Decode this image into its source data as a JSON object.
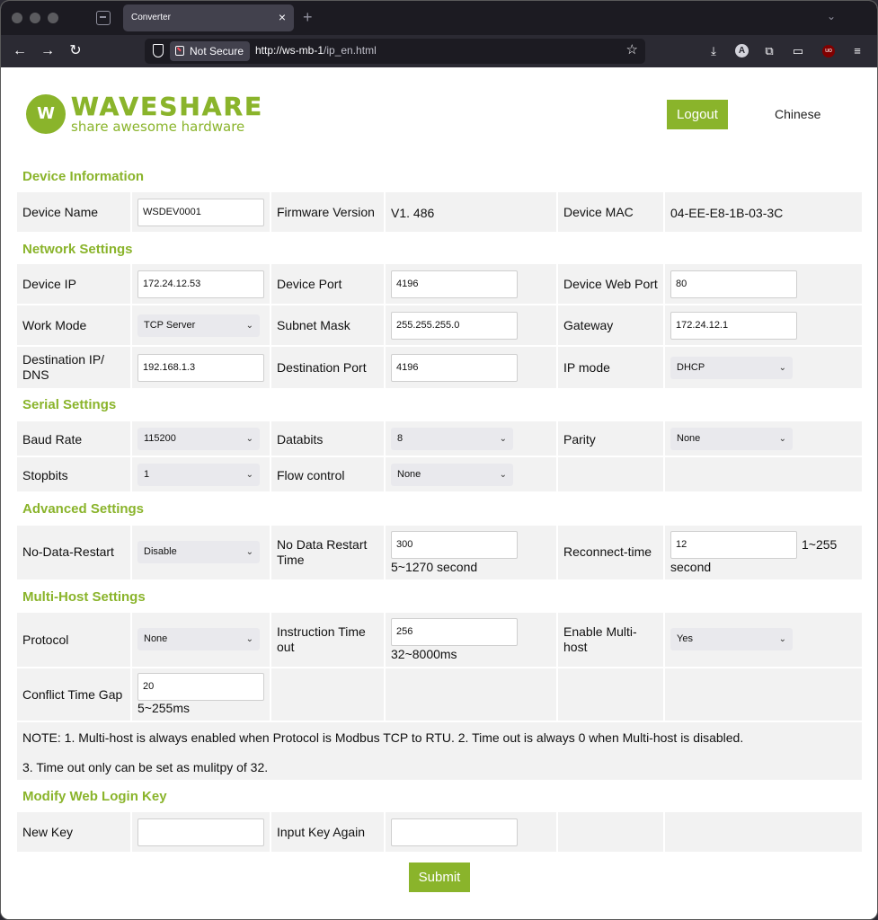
{
  "browser": {
    "tab_title": "Converter",
    "not_secure": "Not Secure",
    "url_host": "http://ws-mb-1",
    "url_path": "/ip_en.html"
  },
  "header": {
    "logo_badge": "W",
    "brand": "WAVESHARE",
    "tagline": "share awesome hardware",
    "logout": "Logout",
    "language": "Chinese"
  },
  "device_info": {
    "title": "Device Information",
    "device_name_label": "Device Name",
    "device_name": "WSDEV0001",
    "firmware_label": "Firmware Version",
    "firmware": "V1. 486",
    "mac_label": "Device MAC",
    "mac": "04-EE-E8-1B-03-3C"
  },
  "network": {
    "title": "Network Settings",
    "device_ip_label": "Device IP",
    "device_ip": "172.24.12.53",
    "device_port_label": "Device Port",
    "device_port": "4196",
    "web_port_label": "Device Web Port",
    "web_port": "80",
    "work_mode_label": "Work Mode",
    "work_mode": "TCP Server",
    "subnet_label": "Subnet Mask",
    "subnet": "255.255.255.0",
    "gateway_label": "Gateway",
    "gateway": "172.24.12.1",
    "dest_ip_label_1": "Destination IP/",
    "dest_ip_label_2": "DNS",
    "dest_ip": "192.168.1.3",
    "dest_port_label": "Destination Port",
    "dest_port": "4196",
    "ip_mode_label": "IP mode",
    "ip_mode": "DHCP"
  },
  "serial": {
    "title": "Serial Settings",
    "baud_label": "Baud Rate",
    "baud": "115200",
    "databits_label": "Databits",
    "databits": "8",
    "parity_label": "Parity",
    "parity": "None",
    "stopbits_label": "Stopbits",
    "stopbits": "1",
    "flow_label": "Flow control",
    "flow": "None"
  },
  "advanced": {
    "title": "Advanced Settings",
    "ndr_label": "No-Data-Restart",
    "ndr": "Disable",
    "ndr_time_label_1": "No Data Restart",
    "ndr_time_label_2": "Time",
    "ndr_time": "300",
    "ndr_time_hint": "5~1270 second",
    "reconnect_label": "Reconnect-time",
    "reconnect": "12",
    "reconnect_hint_1": "1~255",
    "reconnect_hint_2": "second"
  },
  "multihost": {
    "title": "Multi-Host Settings",
    "protocol_label": "Protocol",
    "protocol": "None",
    "timeout_label_1": "Instruction Time",
    "timeout_label_2": "out",
    "timeout": "256",
    "timeout_hint": "32~8000ms",
    "enable_label_1": "Enable Multi-",
    "enable_label_2": "host",
    "enable": "Yes",
    "gap_label": "Conflict Time Gap",
    "gap": "20",
    "gap_hint": "5~255ms",
    "note_1": "NOTE: 1. Multi-host is always enabled when Protocol is Modbus TCP to RTU. 2. Time out is always 0 when Multi-host is disabled.",
    "note_2": "3. Time out only can be set as mulitpy of 32."
  },
  "login_key": {
    "title": "Modify Web Login Key",
    "new_key_label": "New Key",
    "new_key": "",
    "again_label": "Input Key Again",
    "again": ""
  },
  "submit": "Submit",
  "colors": {
    "accent": "#8ab42b",
    "cell_bg": "#f2f2f2",
    "chrome": "#2b2a33"
  }
}
